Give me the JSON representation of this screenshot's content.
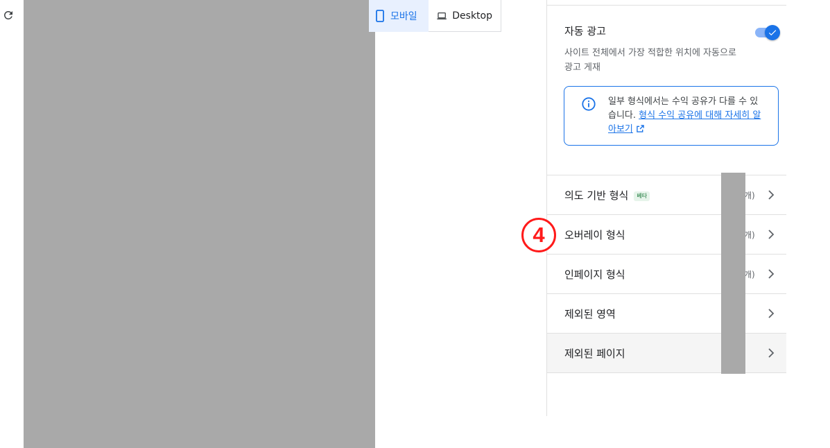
{
  "toolbar": {
    "refresh_icon": "refresh-icon",
    "device_mobile_label": "모바일",
    "device_desktop_label": "Desktop"
  },
  "panel": {
    "auto_ads": {
      "title": "자동 광고",
      "enabled": true,
      "description": "사이트 전체에서 가장 적합한 위치에 자동으로 광고 게재"
    },
    "info": {
      "text": "일부 형식에서는 수익 공유가 다를 수 있습니다. ",
      "link_text": "형식 수익 공유에 대해 자세히 알아보기"
    },
    "rows": [
      {
        "label": "의도 기반 형식",
        "badge": "베타",
        "count": "개)"
      },
      {
        "label": "오버레이 형식",
        "count": "개)"
      },
      {
        "label": "인페이지 형식",
        "count": "개)"
      },
      {
        "label": "제외된 영역"
      },
      {
        "label": "제외된 페이지"
      }
    ]
  },
  "annotation": {
    "step_number": "4"
  },
  "colors": {
    "accent": "#1a73e8",
    "accent_light": "#e8f0fe",
    "marker": "#ff1a1a",
    "redaction": "#a9a9a9"
  }
}
